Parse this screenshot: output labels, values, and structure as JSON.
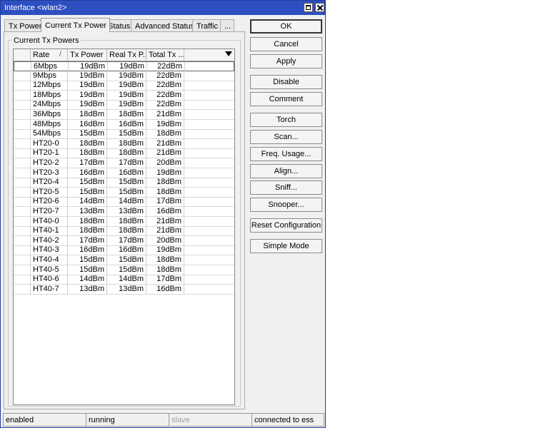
{
  "window": {
    "title": "Interface <wlan2>"
  },
  "tabs": [
    "Tx Power",
    "Current Tx Power",
    "Status",
    "Advanced Status",
    "Traffic",
    "..."
  ],
  "group_label": "Current Tx Powers",
  "table": {
    "columns": [
      "Rate",
      "Tx Power",
      "Real Tx P...",
      "Total Tx ..."
    ],
    "sort_indicator": "/",
    "rows": [
      [
        "6Mbps",
        "19dBm",
        "19dBm",
        "22dBm"
      ],
      [
        "9Mbps",
        "19dBm",
        "19dBm",
        "22dBm"
      ],
      [
        "12Mbps",
        "19dBm",
        "19dBm",
        "22dBm"
      ],
      [
        "18Mbps",
        "19dBm",
        "19dBm",
        "22dBm"
      ],
      [
        "24Mbps",
        "19dBm",
        "19dBm",
        "22dBm"
      ],
      [
        "36Mbps",
        "18dBm",
        "18dBm",
        "21dBm"
      ],
      [
        "48Mbps",
        "16dBm",
        "16dBm",
        "19dBm"
      ],
      [
        "54Mbps",
        "15dBm",
        "15dBm",
        "18dBm"
      ],
      [
        "HT20-0",
        "18dBm",
        "18dBm",
        "21dBm"
      ],
      [
        "HT20-1",
        "18dBm",
        "18dBm",
        "21dBm"
      ],
      [
        "HT20-2",
        "17dBm",
        "17dBm",
        "20dBm"
      ],
      [
        "HT20-3",
        "16dBm",
        "16dBm",
        "19dBm"
      ],
      [
        "HT20-4",
        "15dBm",
        "15dBm",
        "18dBm"
      ],
      [
        "HT20-5",
        "15dBm",
        "15dBm",
        "18dBm"
      ],
      [
        "HT20-6",
        "14dBm",
        "14dBm",
        "17dBm"
      ],
      [
        "HT20-7",
        "13dBm",
        "13dBm",
        "16dBm"
      ],
      [
        "HT40-0",
        "18dBm",
        "18dBm",
        "21dBm"
      ],
      [
        "HT40-1",
        "18dBm",
        "18dBm",
        "21dBm"
      ],
      [
        "HT40-2",
        "17dBm",
        "17dBm",
        "20dBm"
      ],
      [
        "HT40-3",
        "16dBm",
        "16dBm",
        "19dBm"
      ],
      [
        "HT40-4",
        "15dBm",
        "15dBm",
        "18dBm"
      ],
      [
        "HT40-5",
        "15dBm",
        "15dBm",
        "18dBm"
      ],
      [
        "HT40-6",
        "14dBm",
        "14dBm",
        "17dBm"
      ],
      [
        "HT40-7",
        "13dBm",
        "13dBm",
        "16dBm"
      ]
    ]
  },
  "buttons": {
    "ok": "OK",
    "cancel": "Cancel",
    "apply": "Apply",
    "disable": "Disable",
    "comment": "Comment",
    "torch": "Torch",
    "scan": "Scan...",
    "freq_usage": "Freq. Usage...",
    "align": "Align...",
    "sniff": "Sniff...",
    "snooper": "Snooper...",
    "reset_configuration": "Reset Configuration",
    "simple_mode": "Simple Mode"
  },
  "status": {
    "state": "enabled",
    "running": "running",
    "slave": "slave",
    "connection": "connected to ess"
  },
  "colors": {
    "titlebar": "#2d4fc0",
    "window_bg": "#f0f0f0"
  }
}
